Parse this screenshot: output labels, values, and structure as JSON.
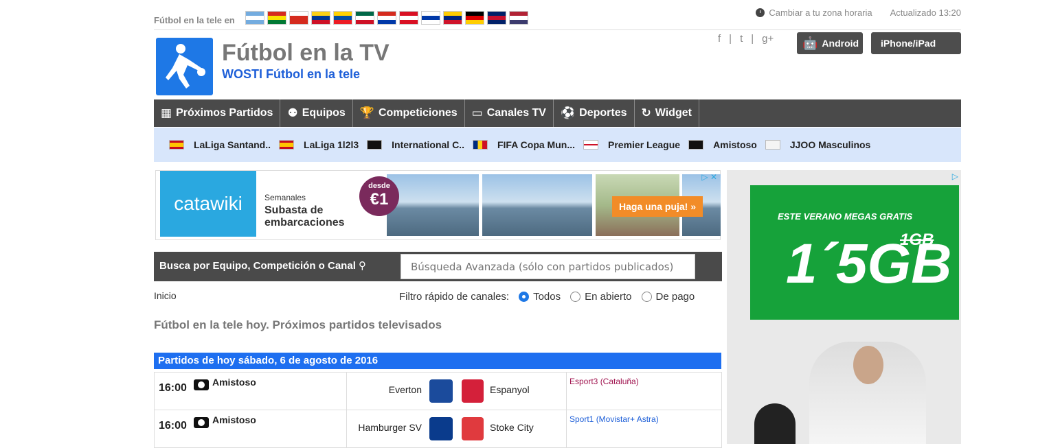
{
  "topbar": {
    "label": "Fútbol en la tele en",
    "flags": [
      {
        "name": "argentina",
        "c": [
          "#74acdf",
          "#ffffff",
          "#74acdf"
        ]
      },
      {
        "name": "bolivia",
        "c": [
          "#d52b1e",
          "#f9e300",
          "#007934"
        ]
      },
      {
        "name": "chile",
        "c": [
          "#ffffff",
          "#d52b1e",
          "#d52b1e"
        ]
      },
      {
        "name": "colombia",
        "c": [
          "#fcd116",
          "#003893",
          "#ce1126"
        ]
      },
      {
        "name": "ecuador",
        "c": [
          "#ffd100",
          "#034ea2",
          "#ed1c24"
        ]
      },
      {
        "name": "mexico",
        "c": [
          "#006847",
          "#ffffff",
          "#ce1126"
        ]
      },
      {
        "name": "paraguay",
        "c": [
          "#d52b1e",
          "#ffffff",
          "#0038a8"
        ]
      },
      {
        "name": "peru",
        "c": [
          "#d91023",
          "#ffffff",
          "#d91023"
        ]
      },
      {
        "name": "uruguay",
        "c": [
          "#ffffff",
          "#0038a8",
          "#ffffff"
        ]
      },
      {
        "name": "venezuela",
        "c": [
          "#ffcc00",
          "#00247d",
          "#cf142b"
        ]
      },
      {
        "name": "germany",
        "c": [
          "#000000",
          "#dd0000",
          "#ffce00"
        ]
      },
      {
        "name": "uk",
        "c": [
          "#012169",
          "#c8102e",
          "#012169"
        ]
      },
      {
        "name": "usa",
        "c": [
          "#b22234",
          "#ffffff",
          "#3c3b6e"
        ]
      }
    ],
    "timezone": "Cambiar a tu zona horaria",
    "updated": "Actualizado 13:20"
  },
  "header": {
    "title": "Fútbol en la TV",
    "subtitle": "WOSTI Fútbol en la tele",
    "social": [
      "f",
      "|",
      "t",
      "|",
      "g+"
    ],
    "android": "Android",
    "iphone": "iPhone/iPad"
  },
  "nav": [
    {
      "label": "Próximos Partidos",
      "icon": "calendar-icon",
      "glyph": "▦"
    },
    {
      "label": "Equipos",
      "icon": "people-icon",
      "glyph": "⚉"
    },
    {
      "label": "Competiciones",
      "icon": "trophy-icon",
      "glyph": "🏆"
    },
    {
      "label": "Canales TV",
      "icon": "tv-icon",
      "glyph": "▭"
    },
    {
      "label": "Deportes",
      "icon": "balls-icon",
      "glyph": "⚽"
    },
    {
      "label": "Widget",
      "icon": "refresh-icon",
      "glyph": "↻"
    }
  ],
  "competitions": [
    {
      "label": "LaLiga Santand..",
      "flag": "spain"
    },
    {
      "label": "LaLiga 1l2l3",
      "flag": "spain"
    },
    {
      "label": "International C..",
      "flag": "ball"
    },
    {
      "label": "FIFA Copa Mun...",
      "flag": "romania"
    },
    {
      "label": "Premier League",
      "flag": "england"
    },
    {
      "label": "Amistoso",
      "flag": "ball"
    },
    {
      "label": "JJOO Masculinos",
      "flag": "olympics"
    }
  ],
  "ad1": {
    "brand1": "cata",
    "brand2": "wiki",
    "line1": "Semanales",
    "line2a": "Subasta de",
    "line2b": "embarcaciones",
    "badge_top": "desde",
    "badge_price": "€1",
    "cta": "Haga una puja! »"
  },
  "search": {
    "label": "Busca por Equipo, Competición o Canal",
    "placeholder": "Búsqueda Avanzada (sólo con partidos publicados)"
  },
  "breadcrumb": "Inicio",
  "filter": {
    "label": "Filtro rápido de canales:",
    "options": [
      "Todos",
      "En abierto",
      "De pago"
    ],
    "selected": "Todos"
  },
  "page_title": "Fútbol en la tele hoy. Próximos partidos televisados",
  "day_header": "Partidos de hoy sábado, 6 de agosto de 2016",
  "matches": [
    {
      "time": "16:00",
      "competition": "Amistoso",
      "home": "Everton",
      "away": "Espanyol",
      "channel": "Esport3 (Cataluña)",
      "channel_color": "#a0144f",
      "home_color": "#1b4b9c",
      "away_color": "#d4203a"
    },
    {
      "time": "16:00",
      "competition": "Amistoso",
      "home": "Hamburger SV",
      "away": "Stoke City",
      "channel": "Sport1 (Movistar+ Astra)",
      "channel_color": "#1e5fd8",
      "home_color": "#0a3b8c",
      "away_color": "#e03a3e"
    }
  ],
  "ad2": {
    "line1": "ESTE VERANO MEGAS GRATIS",
    "big": "1´5GB",
    "strike": "1GB"
  }
}
